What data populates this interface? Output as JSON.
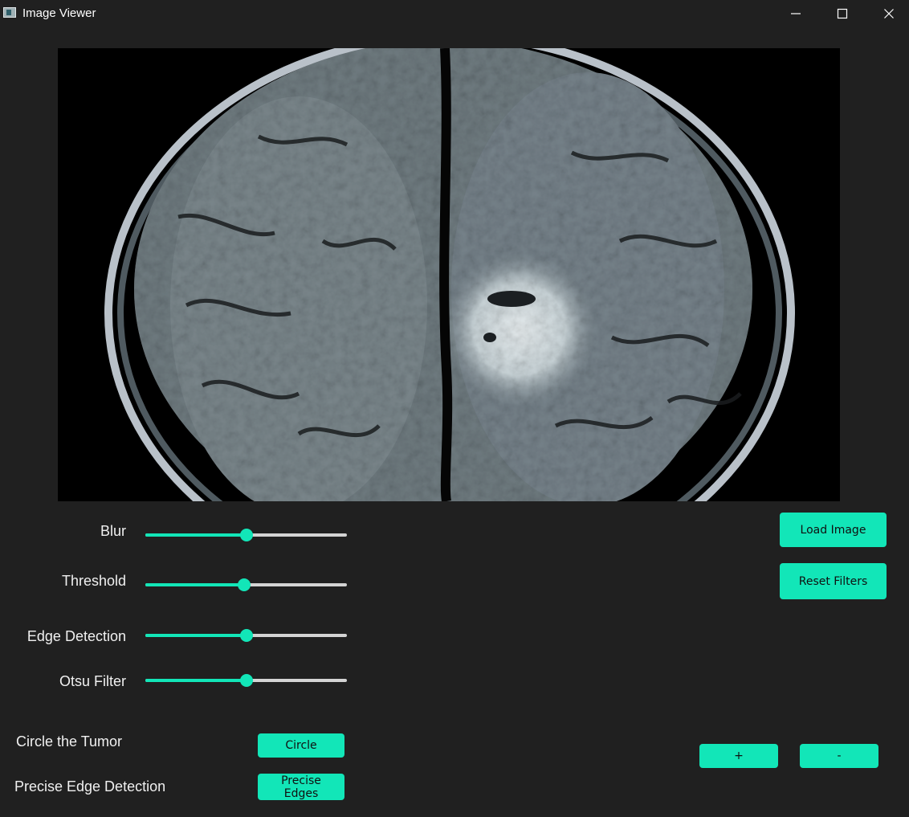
{
  "window": {
    "title": "Image Viewer",
    "controls": [
      "minimize-icon",
      "maximize-icon",
      "close-icon"
    ]
  },
  "sliders": [
    {
      "id": "blur",
      "label": "Blur",
      "value": 0.5
    },
    {
      "id": "threshold",
      "label": "Threshold",
      "value": 0.49
    },
    {
      "id": "edge-detection",
      "label": "Edge Detection",
      "value": 0.5
    },
    {
      "id": "otsu-filter",
      "label": "Otsu Filter",
      "value": 0.5
    }
  ],
  "circle_row": {
    "label": "Circle the Tumor",
    "button": "Circle"
  },
  "edges_row": {
    "label": "Precise Edge Detection",
    "button": "Precise Edges"
  },
  "buttons": {
    "load": "Load Image",
    "reset": "Reset Filters",
    "zoom_in": "+",
    "zoom_out": "-"
  },
  "colors": {
    "accent": "#12e6b8",
    "background": "#202020",
    "track": "#d4d4d4"
  }
}
